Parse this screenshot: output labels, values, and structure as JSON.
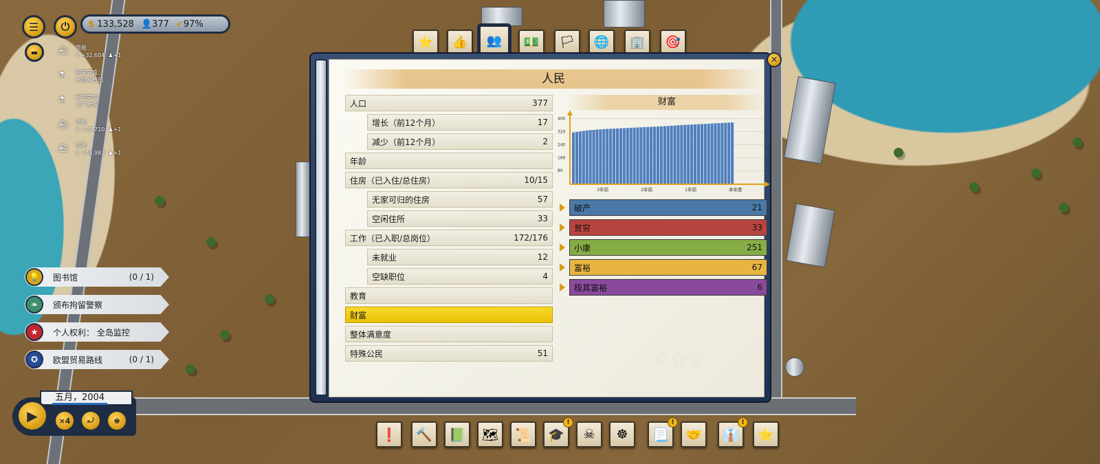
{
  "hud": {
    "money": "133,528",
    "population": "377",
    "approval": "97%"
  },
  "notifications": [
    {
      "icon": "ship-icon",
      "title": "货船",
      "detail": "$ +32,604",
      "extra": "+1"
    },
    {
      "icon": "flask-icon",
      "title": "研究完成：",
      "detail": "水培种植园",
      "extra": ""
    },
    {
      "icon": "flask-icon",
      "title": "研究完成：",
      "detail": "工厂牧场",
      "extra": ""
    },
    {
      "icon": "ship-icon",
      "title": "货船",
      "detail": "$ +35,710",
      "extra": "+1"
    },
    {
      "icon": "ship-icon",
      "title": "货船",
      "detail": "$ +43,983",
      "extra": "+1"
    }
  ],
  "objectives": [
    {
      "label": "图书馆",
      "count": "(0 / 1)",
      "color": "#d7a61a"
    },
    {
      "label": "颁布拘留警察",
      "count": "",
      "color": "#3c8f6b"
    },
    {
      "label": "个人权利：  全岛监控",
      "count": "",
      "color": "#c0262c"
    },
    {
      "label": "欧盟贸易路线",
      "count": "(0 / 1)",
      "color": "#2a4a9a"
    }
  ],
  "time": {
    "date": "五月，2004",
    "speed": "×4"
  },
  "panel": {
    "title": "人民",
    "rows": [
      {
        "label": "人口",
        "value": "377"
      },
      {
        "label": "增长（前12个月）",
        "value": "17"
      },
      {
        "label": "减少（前12个月）",
        "value": "2"
      },
      {
        "label": "年龄",
        "value": ""
      },
      {
        "label": "住房（已入住/总住房）",
        "value": "10/15"
      },
      {
        "label": "无家可归的住房",
        "value": "57"
      },
      {
        "label": "空闲住所",
        "value": "33"
      },
      {
        "label": "工作（已入职/总岗位）",
        "value": "172/176"
      },
      {
        "label": "未就业",
        "value": "12"
      },
      {
        "label": "空缺职位",
        "value": "4"
      },
      {
        "label": "教育",
        "value": ""
      },
      {
        "label": "财富",
        "value": ""
      },
      {
        "label": "整体满意度",
        "value": ""
      },
      {
        "label": "特殊公民",
        "value": "51"
      }
    ],
    "wealth_classes": [
      {
        "label": "破产",
        "value": "21",
        "color": "#4a79a8"
      },
      {
        "label": "贫穷",
        "value": "33",
        "color": "#b8443f"
      },
      {
        "label": "小康",
        "value": "251",
        "color": "#86ad45"
      },
      {
        "label": "富裕",
        "value": "67",
        "color": "#e8b540"
      },
      {
        "label": "极其富裕",
        "value": "6",
        "color": "#8a4a9c"
      }
    ]
  },
  "chart_data": {
    "type": "bar",
    "title": "财富",
    "yticks": [
      80,
      160,
      240,
      320,
      400
    ],
    "ylim": [
      0,
      420
    ],
    "xticks": [
      "3年前",
      "2年前",
      "1年前",
      "本年度"
    ],
    "values": [
      315,
      318,
      322,
      325,
      328,
      330,
      331,
      333,
      334,
      336,
      337,
      338,
      339,
      340,
      341,
      342,
      343,
      344,
      345,
      346,
      347,
      348,
      349,
      350,
      351,
      352,
      353,
      354,
      355,
      357,
      358,
      360,
      361,
      362,
      363,
      364,
      365,
      366,
      367,
      368,
      369,
      371,
      372,
      373,
      374,
      375,
      376,
      377
    ],
    "bar_color": "#4f7fbf",
    "grid": true
  }
}
